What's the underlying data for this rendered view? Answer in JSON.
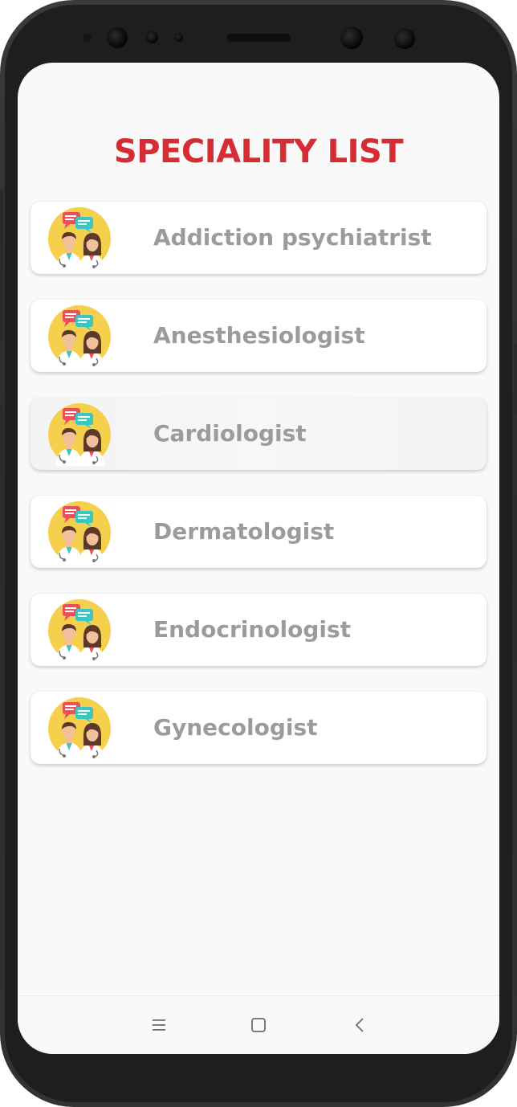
{
  "screen": {
    "title": "SPECIALITY LIST"
  },
  "specialities": [
    {
      "label": "Addiction psychiatrist",
      "icon": "doctors-chat-icon"
    },
    {
      "label": "Anesthesiologist",
      "icon": "doctors-chat-icon"
    },
    {
      "label": "Cardiologist",
      "icon": "doctors-chat-icon",
      "pressed": true
    },
    {
      "label": "Dermatologist",
      "icon": "doctors-chat-icon"
    },
    {
      "label": "Endocrinologist",
      "icon": "doctors-chat-icon"
    },
    {
      "label": "Gynecologist",
      "icon": "doctors-chat-icon"
    }
  ],
  "navbar": {
    "recent_icon": "recent-apps-icon",
    "home_icon": "home-icon",
    "back_icon": "back-icon"
  },
  "colors": {
    "title": "#d62c33",
    "label": "#9b9b9b",
    "avatar_bg": "#f6d04d",
    "bubble_red": "#e9505a",
    "bubble_teal": "#3cc6c0",
    "background": "#f9f9f9"
  }
}
